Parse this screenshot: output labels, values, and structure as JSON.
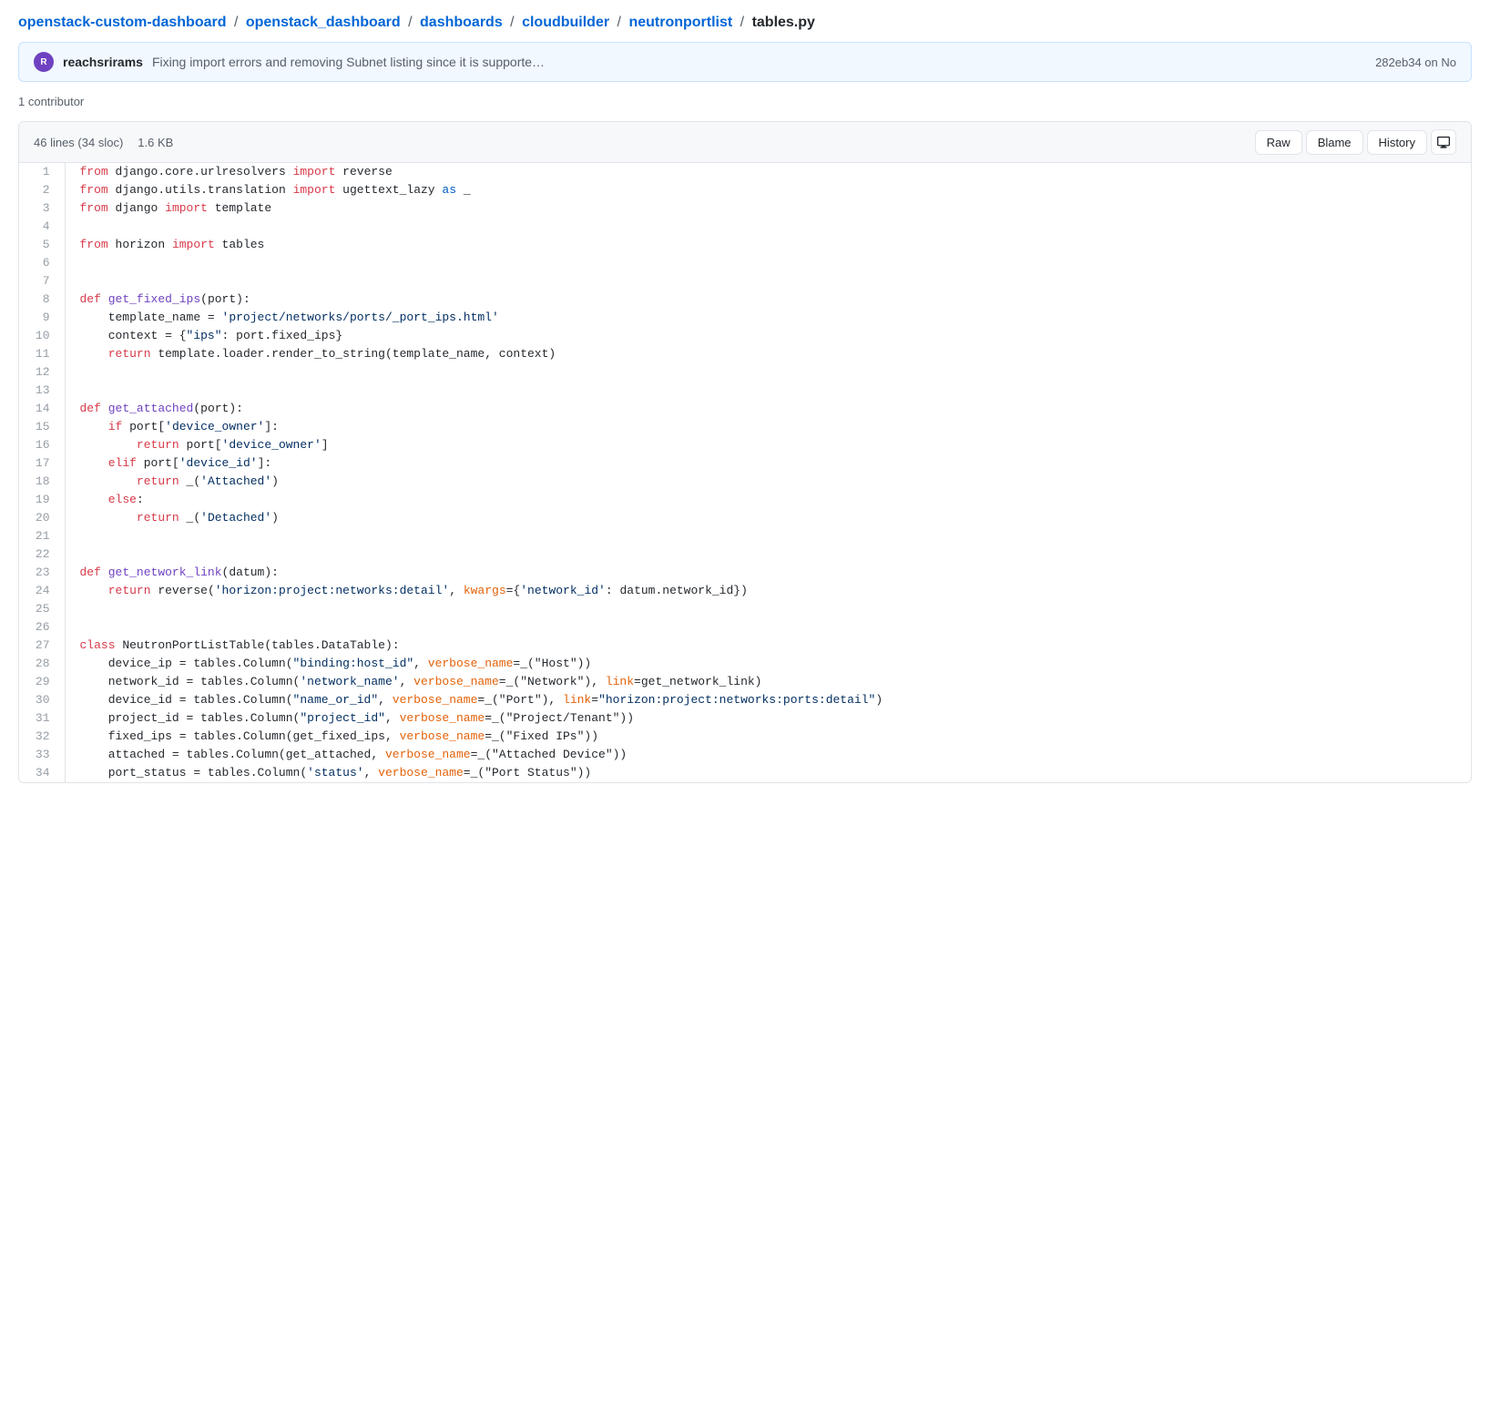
{
  "breadcrumb": {
    "parts": [
      {
        "label": "openstack-custom-dashboard",
        "href": "#"
      },
      {
        "label": "openstack_dashboard",
        "href": "#"
      },
      {
        "label": "dashboards",
        "href": "#"
      },
      {
        "label": "cloudbuilder",
        "href": "#"
      },
      {
        "label": "neutronportlist",
        "href": "#"
      },
      {
        "label": "tables.py",
        "isFile": true
      }
    ]
  },
  "commit": {
    "author": "reachsrirams",
    "message": "Fixing import errors and removing Subnet listing since it is supporte…",
    "hash": "282eb34 on No"
  },
  "contributors": "1 contributor",
  "file": {
    "lines": "46 lines (34 sloc)",
    "size": "1.6 KB",
    "actions": {
      "raw": "Raw",
      "blame": "Blame",
      "history": "History"
    }
  },
  "code": [
    {
      "n": 1,
      "tokens": [
        {
          "t": "kw",
          "v": "from"
        },
        {
          "t": "plain",
          "v": " django.core.urlresolvers "
        },
        {
          "t": "kw",
          "v": "import"
        },
        {
          "t": "plain",
          "v": " reverse"
        }
      ]
    },
    {
      "n": 2,
      "tokens": [
        {
          "t": "kw",
          "v": "from"
        },
        {
          "t": "plain",
          "v": " django.utils.translation "
        },
        {
          "t": "kw",
          "v": "import"
        },
        {
          "t": "plain",
          "v": " ugettext_lazy "
        },
        {
          "t": "kw2",
          "v": "as"
        },
        {
          "t": "plain",
          "v": " _"
        }
      ]
    },
    {
      "n": 3,
      "tokens": [
        {
          "t": "kw",
          "v": "from"
        },
        {
          "t": "plain",
          "v": " django "
        },
        {
          "t": "kw",
          "v": "import"
        },
        {
          "t": "plain",
          "v": " template"
        }
      ]
    },
    {
      "n": 4,
      "tokens": []
    },
    {
      "n": 5,
      "tokens": [
        {
          "t": "kw",
          "v": "from"
        },
        {
          "t": "plain",
          "v": " horizon "
        },
        {
          "t": "kw",
          "v": "import"
        },
        {
          "t": "plain",
          "v": " tables"
        }
      ]
    },
    {
      "n": 6,
      "tokens": []
    },
    {
      "n": 7,
      "tokens": []
    },
    {
      "n": 8,
      "tokens": [
        {
          "t": "kw",
          "v": "def"
        },
        {
          "t": "plain",
          "v": " "
        },
        {
          "t": "fn",
          "v": "get_fixed_ips"
        },
        {
          "t": "plain",
          "v": "(port):"
        }
      ]
    },
    {
      "n": 9,
      "tokens": [
        {
          "t": "plain",
          "v": "    template_name = "
        },
        {
          "t": "str",
          "v": "'project/networks/ports/_port_ips.html'"
        }
      ]
    },
    {
      "n": 10,
      "tokens": [
        {
          "t": "plain",
          "v": "    context = {"
        },
        {
          "t": "str",
          "v": "\"ips\""
        },
        {
          "t": "plain",
          "v": ": port.fixed_ips}"
        }
      ]
    },
    {
      "n": 11,
      "tokens": [
        {
          "t": "plain",
          "v": "    "
        },
        {
          "t": "kw",
          "v": "return"
        },
        {
          "t": "plain",
          "v": " template.loader.render_to_string(template_name, context)"
        }
      ]
    },
    {
      "n": 12,
      "tokens": []
    },
    {
      "n": 13,
      "tokens": []
    },
    {
      "n": 14,
      "tokens": [
        {
          "t": "kw",
          "v": "def"
        },
        {
          "t": "plain",
          "v": " "
        },
        {
          "t": "fn",
          "v": "get_attached"
        },
        {
          "t": "plain",
          "v": "(port):"
        }
      ]
    },
    {
      "n": 15,
      "tokens": [
        {
          "t": "plain",
          "v": "    "
        },
        {
          "t": "kw",
          "v": "if"
        },
        {
          "t": "plain",
          "v": " port["
        },
        {
          "t": "str",
          "v": "'device_owner'"
        },
        {
          "t": "plain",
          "v": "]:"
        }
      ]
    },
    {
      "n": 16,
      "tokens": [
        {
          "t": "plain",
          "v": "        "
        },
        {
          "t": "kw",
          "v": "return"
        },
        {
          "t": "plain",
          "v": " port["
        },
        {
          "t": "str",
          "v": "'device_owner'"
        },
        {
          "t": "plain",
          "v": "]"
        }
      ]
    },
    {
      "n": 17,
      "tokens": [
        {
          "t": "plain",
          "v": "    "
        },
        {
          "t": "kw",
          "v": "elif"
        },
        {
          "t": "plain",
          "v": " port["
        },
        {
          "t": "str",
          "v": "'device_id'"
        },
        {
          "t": "plain",
          "v": "]:"
        }
      ]
    },
    {
      "n": 18,
      "tokens": [
        {
          "t": "plain",
          "v": "        "
        },
        {
          "t": "kw",
          "v": "return"
        },
        {
          "t": "plain",
          "v": " _("
        },
        {
          "t": "str",
          "v": "'Attached'"
        },
        {
          "t": "plain",
          "v": ")"
        }
      ]
    },
    {
      "n": 19,
      "tokens": [
        {
          "t": "plain",
          "v": "    "
        },
        {
          "t": "kw",
          "v": "else"
        },
        {
          "t": "plain",
          "v": ":"
        }
      ]
    },
    {
      "n": 20,
      "tokens": [
        {
          "t": "plain",
          "v": "        "
        },
        {
          "t": "kw",
          "v": "return"
        },
        {
          "t": "plain",
          "v": " _("
        },
        {
          "t": "str",
          "v": "'Detached'"
        },
        {
          "t": "plain",
          "v": ")"
        }
      ]
    },
    {
      "n": 21,
      "tokens": []
    },
    {
      "n": 22,
      "tokens": []
    },
    {
      "n": 23,
      "tokens": [
        {
          "t": "kw",
          "v": "def"
        },
        {
          "t": "plain",
          "v": " "
        },
        {
          "t": "fn",
          "v": "get_network_link"
        },
        {
          "t": "plain",
          "v": "(datum):"
        }
      ]
    },
    {
      "n": 24,
      "tokens": [
        {
          "t": "plain",
          "v": "    "
        },
        {
          "t": "kw",
          "v": "return"
        },
        {
          "t": "plain",
          "v": " reverse("
        },
        {
          "t": "str",
          "v": "'horizon:project:networks:detail'"
        },
        {
          "t": "plain",
          "v": ", "
        },
        {
          "t": "param",
          "v": "kwargs"
        },
        {
          "t": "plain",
          "v": "={"
        },
        {
          "t": "str",
          "v": "'network_id'"
        },
        {
          "t": "plain",
          "v": ": datum.network_id})"
        }
      ]
    },
    {
      "n": 25,
      "tokens": []
    },
    {
      "n": 26,
      "tokens": []
    },
    {
      "n": 27,
      "tokens": [
        {
          "t": "kw",
          "v": "class"
        },
        {
          "t": "plain",
          "v": " NeutronPortListTable(tables.DataTable):"
        }
      ]
    },
    {
      "n": 28,
      "tokens": [
        {
          "t": "plain",
          "v": "    device_ip = tables.Column("
        },
        {
          "t": "str",
          "v": "\"binding:host_id\""
        },
        {
          "t": "plain",
          "v": ", "
        },
        {
          "t": "param",
          "v": "verbose_name"
        },
        {
          "t": "plain",
          "v": "=_(\"Host\"))"
        }
      ]
    },
    {
      "n": 29,
      "tokens": [
        {
          "t": "plain",
          "v": "    network_id = tables.Column("
        },
        {
          "t": "str",
          "v": "'network_name'"
        },
        {
          "t": "plain",
          "v": ", "
        },
        {
          "t": "param",
          "v": "verbose_name"
        },
        {
          "t": "plain",
          "v": "=_(\"Network\"), "
        },
        {
          "t": "param",
          "v": "link"
        },
        {
          "t": "plain",
          "v": "=get_network_link)"
        }
      ]
    },
    {
      "n": 30,
      "tokens": [
        {
          "t": "plain",
          "v": "    device_id = tables.Column("
        },
        {
          "t": "str",
          "v": "\"name_or_id\""
        },
        {
          "t": "plain",
          "v": ", "
        },
        {
          "t": "param",
          "v": "verbose_name"
        },
        {
          "t": "plain",
          "v": "=_(\"Port\"), "
        },
        {
          "t": "param",
          "v": "link"
        },
        {
          "t": "plain",
          "v": "="
        },
        {
          "t": "str",
          "v": "\"horizon:project:networks:ports:detail\""
        },
        {
          "t": "plain",
          "v": ")"
        }
      ]
    },
    {
      "n": 31,
      "tokens": [
        {
          "t": "plain",
          "v": "    project_id = tables.Column("
        },
        {
          "t": "str",
          "v": "\"project_id\""
        },
        {
          "t": "plain",
          "v": ", "
        },
        {
          "t": "param",
          "v": "verbose_name"
        },
        {
          "t": "plain",
          "v": "=_(\"Project/Tenant\"))"
        }
      ]
    },
    {
      "n": 32,
      "tokens": [
        {
          "t": "plain",
          "v": "    fixed_ips = tables.Column(get_fixed_ips, "
        },
        {
          "t": "param",
          "v": "verbose_name"
        },
        {
          "t": "plain",
          "v": "=_(\"Fixed IPs\"))"
        }
      ]
    },
    {
      "n": 33,
      "tokens": [
        {
          "t": "plain",
          "v": "    attached = tables.Column(get_attached, "
        },
        {
          "t": "param",
          "v": "verbose_name"
        },
        {
          "t": "plain",
          "v": "=_(\"Attached Device\"))"
        }
      ]
    },
    {
      "n": 34,
      "tokens": [
        {
          "t": "plain",
          "v": "    port_status = tables.Column("
        },
        {
          "t": "str",
          "v": "'status'"
        },
        {
          "t": "plain",
          "v": ", "
        },
        {
          "t": "param",
          "v": "verbose_name"
        },
        {
          "t": "plain",
          "v": "=_(\"Port Status\"))"
        }
      ]
    }
  ]
}
